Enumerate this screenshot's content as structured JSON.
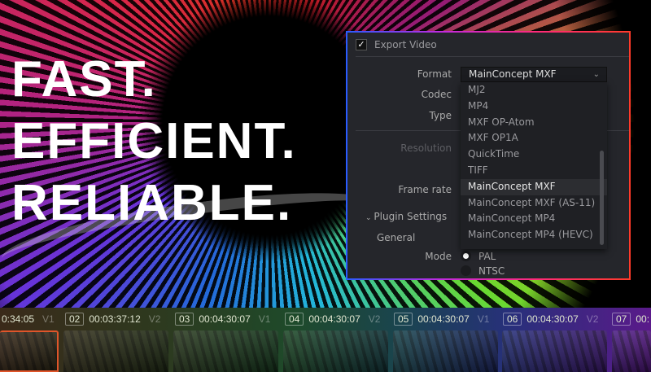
{
  "headline": [
    "FAST.",
    "EFFICIENT.",
    "RELIABLE."
  ],
  "dialog": {
    "export_video": {
      "label": "Export Video",
      "checked": true
    },
    "labels": {
      "format": "Format",
      "codec": "Codec",
      "type": "Type",
      "resolution": "Resolution",
      "frame_rate": "Frame rate",
      "plugin_settings": "Plugin Settings",
      "general": "General",
      "mode": "Mode"
    },
    "format_value": "MainConcept MXF",
    "format_options": [
      "MJ2",
      "MP4",
      "MXF OP-Atom",
      "MXF OP1A",
      "QuickTime",
      "TIFF",
      "MainConcept MXF",
      "MainConcept MXF (AS-11)",
      "MainConcept MP4",
      "MainConcept MP4 (HEVC)"
    ],
    "selected_index": 6,
    "mode_options": [
      {
        "label": "PAL",
        "selected": true
      },
      {
        "label": "NTSC",
        "selected": false
      }
    ]
  },
  "timeline": {
    "clips": [
      {
        "num": "",
        "tc": "0:34:05",
        "track": "V1"
      },
      {
        "num": "02",
        "tc": "00:03:37:12",
        "track": "V2"
      },
      {
        "num": "03",
        "tc": "00:04:30:07",
        "track": "V1"
      },
      {
        "num": "04",
        "tc": "00:04:30:07",
        "track": "V2"
      },
      {
        "num": "05",
        "tc": "00:04:30:07",
        "track": "V1"
      },
      {
        "num": "06",
        "tc": "00:04:30:07",
        "track": "V2"
      },
      {
        "num": "07",
        "tc": "00:",
        "track": ""
      }
    ]
  }
}
